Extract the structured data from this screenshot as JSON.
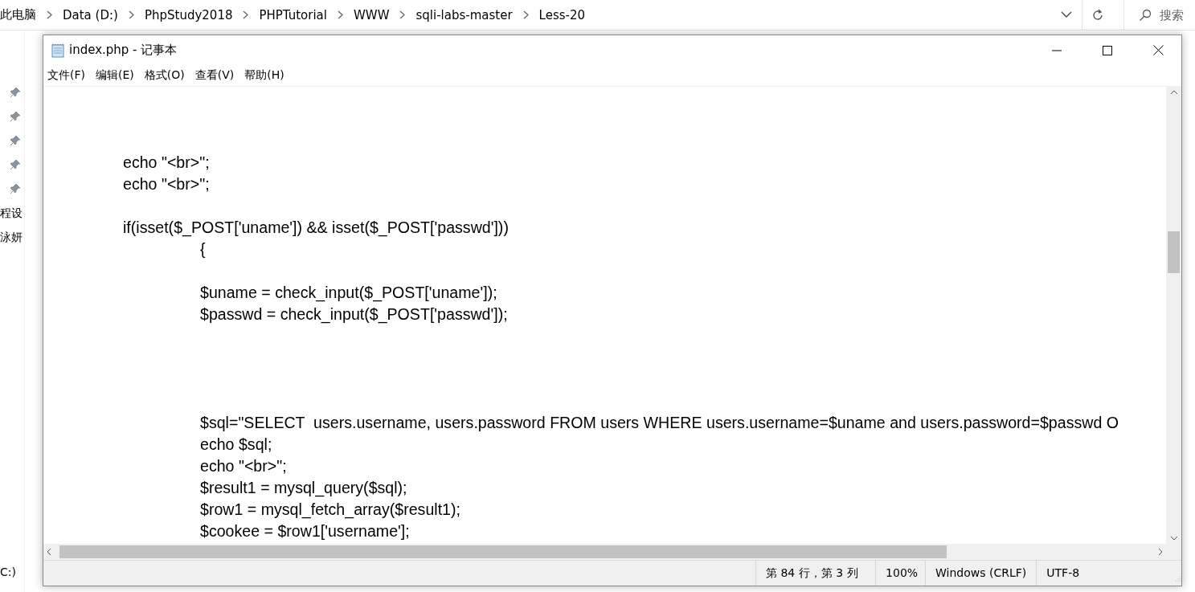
{
  "explorer": {
    "breadcrumbs": [
      "此电脑",
      "Data (D:)",
      "PhpStudy2018",
      "PHPTutorial",
      "WWW",
      "sqli-labs-master",
      "Less-20"
    ],
    "search": {
      "placeholder": "搜索"
    },
    "nav_items": [
      "程设",
      "泳妍",
      "C:)"
    ]
  },
  "notepad": {
    "title": "index.php - 记事本",
    "menu": [
      "文件(F)",
      "编辑(E)",
      "格式(O)",
      "查看(V)",
      "帮助(H)"
    ],
    "code": "\n\n\n\techo \"<br>\";\n\techo \"<br>\";\n\n\tif(isset($_POST['uname']) && isset($_POST['passwd']))\n\t\t{\n\n\t\t$uname = check_input($_POST['uname']);\n\t\t$passwd = check_input($_POST['passwd']);\n\n\n\n\n\t\t$sql=\"SELECT  users.username, users.password FROM users WHERE users.username=$uname and users.password=$passwd O\n\t\techo $sql;\n\t\techo \"<br>\";\n\t\t$result1 = mysql_query($sql);\n\t\t$row1 = mysql_fetch_array($result1);\n\t\t$cookee = $row1['username'];",
    "status": [
      "第 84 行，第 3 列",
      "100%",
      "Windows (CRLF)",
      "UTF-8"
    ]
  }
}
